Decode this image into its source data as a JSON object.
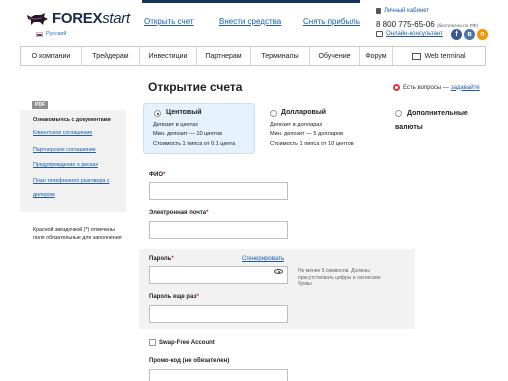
{
  "header": {
    "logo_bold": "FOREX",
    "logo_italic": "start",
    "language": "Русский",
    "links": [
      "Открыть счет",
      "Внести средства",
      "Снять прибыль"
    ],
    "cabinet": "Личный кабинет",
    "phone": "8 800 775-65-06",
    "phone_note": "(бесплатно по РФ)",
    "consultant": "Онлайн-консультант",
    "social": [
      {
        "icon": "facebook-icon",
        "glyph": "f",
        "color": "#3b5998"
      },
      {
        "icon": "vk-icon",
        "glyph": "в",
        "color": "#4c75a3"
      },
      {
        "icon": "odnoklassniki-icon",
        "glyph": "о",
        "color": "#f29400"
      }
    ]
  },
  "nav": {
    "items": [
      "О компании",
      "Трейдерам",
      "Инвестиции",
      "Партнерам",
      "Терминалы",
      "Обучение",
      "Форум",
      "Web terminal"
    ]
  },
  "page": {
    "title": "Открытие счета",
    "help_text": "Есть вопросы —",
    "help_link": "задавайте"
  },
  "sidebar": {
    "pdf_tag": "PDF",
    "heading": "Ознакомьтесь с документами",
    "links": [
      "Клиентское соглашение",
      "Партнерское соглашение",
      "Предупреждение о рисках",
      "План телефонного разговора с",
      "дилером"
    ],
    "note": "Красной звездочкой (*) отмечены поля обязательные для заполнения"
  },
  "accounts": [
    {
      "title": "Центовый",
      "lines": [
        "Депозит в центах",
        "Мин. депозит — 10 центов",
        "Стоимость 1 пипса от 0.1 цента"
      ],
      "selected": true
    },
    {
      "title": "Долларовый",
      "lines": [
        "Депозит в долларах",
        "Мин. депозит — 5 долларов",
        "Стоимость 1 пипса от 10 центов"
      ],
      "selected": false
    },
    {
      "title": "Дополнительные",
      "title2": "валюты",
      "lines": [],
      "selected": false
    }
  ],
  "form": {
    "fio_label": "ФИО",
    "email_label": "Электронная почта",
    "password_label": "Пароль",
    "generate_link": "Сгенерировать",
    "password_hint": "Не менее 5 символов. Должны присутствовать цифры и латинские буквы",
    "password_repeat_label": "Пароль еще раз",
    "swap_free_label": "Swap-Free Account",
    "promo_label": "Промо-код (не обязателен)",
    "required_mark": "*"
  }
}
